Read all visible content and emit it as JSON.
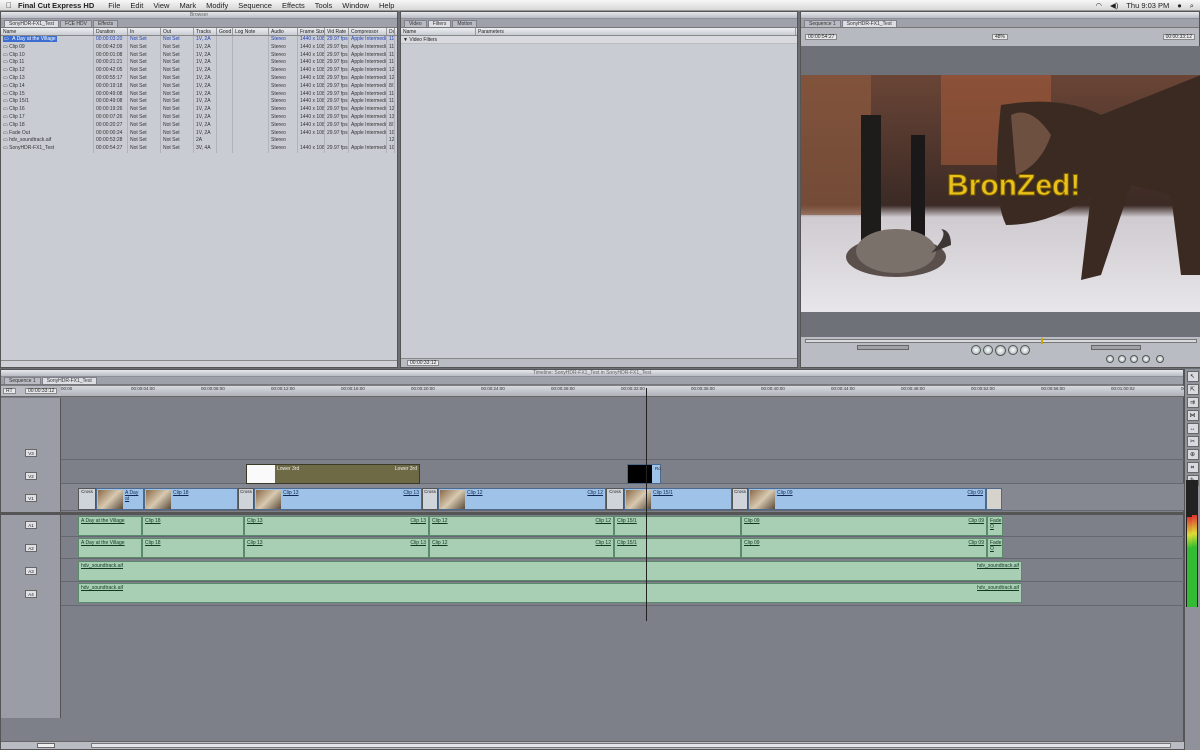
{
  "menubar": {
    "app": "Final Cut Express HD",
    "items": [
      "File",
      "Edit",
      "View",
      "Mark",
      "Modify",
      "Sequence",
      "Effects",
      "Tools",
      "Window",
      "Help"
    ],
    "clock": "Thu 9:03 PM"
  },
  "browser": {
    "title": "Browser",
    "tabs": [
      "SonyHDR-FX1_Test",
      "FCE HDV",
      "Effects"
    ],
    "columns": [
      "Name",
      "Duration",
      "In",
      "Out",
      "Tracks",
      "Good",
      "Log Note",
      "Audio",
      "Frame Size",
      "Vid Rate",
      "Compressor",
      "Da"
    ],
    "rows": [
      [
        "A Day at the Village",
        "00:00:03:20",
        "Not Set",
        "Not Set",
        "1V, 2A",
        "",
        "",
        "Stereo",
        "1440 x 1080",
        "29.97 fps",
        "Apple Intermedia",
        "11"
      ],
      [
        "Clip 09",
        "00:00:42:09",
        "Not Set",
        "Not Set",
        "1V, 2A",
        "",
        "",
        "Stereo",
        "1440 x 1080",
        "29.97 fps",
        "Apple Intermedia",
        "11"
      ],
      [
        "Clip 10",
        "00:00:01:08",
        "Not Set",
        "Not Set",
        "1V, 2A",
        "",
        "",
        "Stereo",
        "1440 x 1080",
        "29.97 fps",
        "Apple Intermedia",
        "11"
      ],
      [
        "Clip 11",
        "00:00:21:21",
        "Not Set",
        "Not Set",
        "1V, 2A",
        "",
        "",
        "Stereo",
        "1440 x 1080",
        "29.97 fps",
        "Apple Intermedia",
        "11"
      ],
      [
        "Clip 12",
        "00:00:42:05",
        "Not Set",
        "Not Set",
        "1V, 2A",
        "",
        "",
        "Stereo",
        "1440 x 1080",
        "29.97 fps",
        "Apple Intermedia",
        "12"
      ],
      [
        "Clip 13",
        "00:00:55:17",
        "Not Set",
        "Not Set",
        "1V, 2A",
        "",
        "",
        "Stereo",
        "1440 x 1080",
        "29.97 fps",
        "Apple Intermedia",
        "12"
      ],
      [
        "Clip 14",
        "00:00:19:18",
        "Not Set",
        "Not Set",
        "1V, 2A",
        "",
        "",
        "Stereo",
        "1440 x 1080",
        "29.97 fps",
        "Apple Intermedia",
        "8/1"
      ],
      [
        "Clip 15",
        "00:00:49:08",
        "Not Set",
        "Not Set",
        "1V, 2A",
        "",
        "",
        "Stereo",
        "1440 x 1080",
        "29.97 fps",
        "Apple Intermedia",
        "11"
      ],
      [
        "Clip 15/1",
        "00:00:49:08",
        "Not Set",
        "Not Set",
        "1V, 2A",
        "",
        "",
        "Stereo",
        "1440 x 1080",
        "29.97 fps",
        "Apple Intermedia",
        "11"
      ],
      [
        "Clip 16",
        "00:00:19:26",
        "Not Set",
        "Not Set",
        "1V, 2A",
        "",
        "",
        "Stereo",
        "1440 x 1080",
        "29.97 fps",
        "Apple Intermedia",
        "12"
      ],
      [
        "Clip 17",
        "00:00:07:26",
        "Not Set",
        "Not Set",
        "1V, 2A",
        "",
        "",
        "Stereo",
        "1440 x 1080",
        "29.97 fps",
        "Apple Intermedia",
        "13"
      ],
      [
        "Clip 18",
        "00:00:20:27",
        "Not Set",
        "Not Set",
        "1V, 2A",
        "",
        "",
        "Stereo",
        "1440 x 1080",
        "29.97 fps",
        "Apple Intermedia",
        "8/1"
      ],
      [
        "Fade Out",
        "00:00:00:24",
        "Not Set",
        "Not Set",
        "1V, 2A",
        "",
        "",
        "Stereo",
        "1440 x 1080",
        "29.97 fps",
        "Apple Intermedia",
        "10"
      ],
      [
        "hdv_soundtrack.aif",
        "00:00:53:28",
        "Not Set",
        "Not Set",
        "2A",
        "",
        "",
        "Stereo",
        "",
        "",
        "",
        "12"
      ],
      [
        "SonyHDR-FX1_Test",
        "00:00:54:27",
        "Not Set",
        "Not Set",
        "3V, 4A",
        "",
        "",
        "Stereo",
        "1440 x 1080",
        "29.97 fps",
        "Apple Intermedia",
        "10"
      ]
    ]
  },
  "viewer": {
    "tabs": [
      "Video",
      "Filters",
      "Motion"
    ],
    "header": [
      "Name",
      "Parameters"
    ],
    "filter_row": "Video Filters",
    "timecode": "00:00:33:12"
  },
  "canvas": {
    "tabs": [
      "Sequence 1",
      "SonyHDR-FX1_Test"
    ],
    "timecode_left": "00:00:54:27",
    "timecode_right": "00:00:33:12",
    "zoom": "48%",
    "overlay_text": "BronZed!"
  },
  "timeline": {
    "title": "Timeline: SonyHDR-FX1_Test in SonyHDR-FX1_Test",
    "tabs": [
      "Sequence 1",
      "SonyHDR-FX1_Test"
    ],
    "rt": "RT",
    "timecode": "00:00:33:12",
    "ruler": [
      "00:00",
      "00:00:04:00",
      "00:00:08:00",
      "00:00:12:00",
      "00:00:16:00",
      "00:00:20:00",
      "00:00:24:00",
      "00:00:28:00",
      "00:00:32:00",
      "00:00:36:00",
      "00:00:40:00",
      "00:00:44:00",
      "00:00:48:00",
      "00:00:52:00",
      "00:00:56:00",
      "00:01:00:02",
      "00:01:04:02"
    ],
    "tracks": [
      "V3",
      "V2",
      "V1",
      "A1",
      "A2",
      "A3",
      "A4"
    ],
    "v2_clips": [
      "Lower 3rd",
      "Lower 3rd",
      "Ro"
    ],
    "v1_clips": [
      "A Day at",
      "Clip 18",
      "Clip 13",
      "Clip 13",
      "Clip 12",
      "Clip 12",
      "Clip 15/1",
      "Clip 09",
      "Clip 09"
    ],
    "cross": "Cross",
    "a_clips": [
      "A Day at the Village",
      "Clip 18",
      "Clip 13",
      "Clip 13",
      "Clip 12",
      "Clip 12",
      "Clip 15/1",
      "Clip 09",
      "Clip 09",
      "Fade O"
    ],
    "soundtrack": "hdv_soundtrack.aif"
  }
}
